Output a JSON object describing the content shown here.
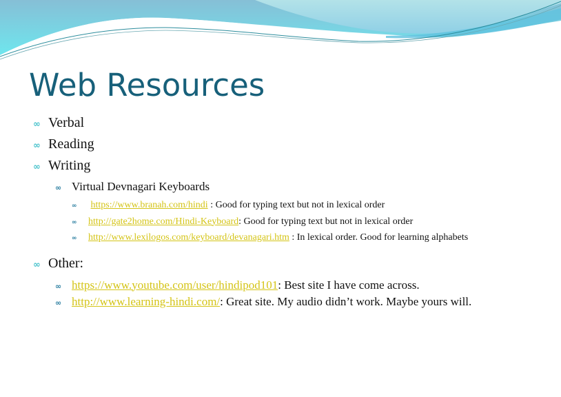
{
  "slide": {
    "title": "Web Resources",
    "colors": {
      "title": "#17607a",
      "link": "#d4c416",
      "bullet_level1": "#4ac3cc",
      "bullet_level2": "#2b7ea0",
      "wave_light": "#a9dde6",
      "wave_mid": "#7cc4d8",
      "wave_line": "#2b8c9c"
    },
    "bullet_icon": "curly-loop-bullet",
    "items": [
      {
        "label": "Verbal"
      },
      {
        "label": "Reading"
      },
      {
        "label": "Writing"
      }
    ],
    "writing_sub": {
      "label": "Virtual Devnagari Keyboards",
      "links": [
        {
          "url": "https://www.branah.com/hindi",
          "note": " : Good for typing text but not in lexical order"
        },
        {
          "url": "http://gate2home.com/Hindi-Keyboard",
          "note": ": Good for typing text but not in lexical order"
        },
        {
          "url": "http://www.lexilogos.com/keyboard/devanagari.htm",
          "note": " : In lexical order. Good for learning alphabets"
        }
      ]
    },
    "other": {
      "label": "Other:",
      "links": [
        {
          "url": "https://www.youtube.com/user/hindipod101",
          "note": ": Best site I have come across."
        },
        {
          "url": "http://www.learning-hindi.com/",
          "note": ": Great site. My audio didn’t work. Maybe yours will."
        }
      ]
    }
  }
}
